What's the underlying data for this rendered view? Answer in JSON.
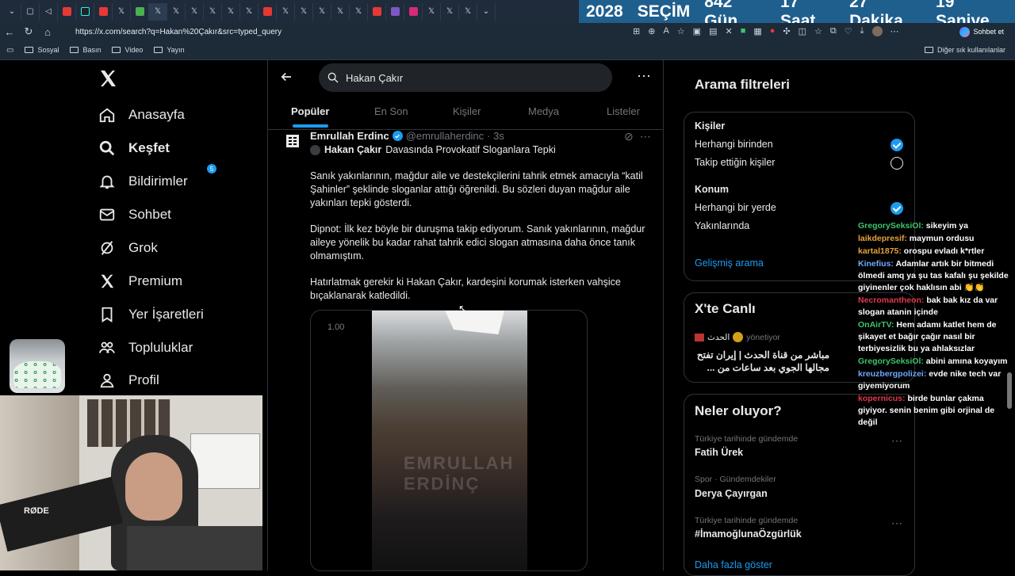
{
  "browser": {
    "countdown": [
      "2028",
      "SEÇİM",
      "842 Gün",
      "17 Saat",
      "27 Dakika",
      "19 Saniye"
    ],
    "url": "https://x.com/search?q=Hakan%20Çakır&src=typed_query",
    "chat_button": "Sohbet et",
    "bookmarks": [
      "Sosyal",
      "Basın",
      "Video",
      "Yayın"
    ],
    "other_bookmarks": "Diğer sık kullanılanlar"
  },
  "nav": {
    "items": [
      "Anasayfa",
      "Keşfet",
      "Bildirimler",
      "Sohbet",
      "Grok",
      "Premium",
      "Yer İşaretleri",
      "Topluluklar",
      "Profil"
    ],
    "notifications_badge": "5"
  },
  "search": {
    "query": "Hakan Çakır",
    "tabs": [
      "Popüler",
      "En Son",
      "Kişiler",
      "Medya",
      "Listeler"
    ]
  },
  "tweet": {
    "author": "Emrullah Erdinc",
    "handle": "@emrullaherdinc",
    "time": "· 3s",
    "headline_bold": "Hakan Çakır",
    "headline_rest": "Davasında Provokatif Sloganlara Tepki",
    "p1": "Sanık yakınlarının, mağdur aile ve destekçilerini tahrik etmek amacıyla “katil Şahinler” şeklinde sloganlar attığı öğrenildi. Bu sözleri duyan mağdur aile yakınları tepki gösterdi.",
    "p2": "Dipnot: İlk kez böyle bir duruşma takip ediyorum. Sanık yakınlarının, mağdur aileye yönelik bu kadar rahat tahrik edici slogan atmasına daha önce tanık olmamıştım.",
    "p3": "Hatırlatmak gerekir ki Hakan Çakır, kardeşini korumak isterken vahşice bıçaklanarak katledildi.",
    "video_speed": "1.00",
    "watermark": "EMRULLAH ERDİNÇ"
  },
  "filters": {
    "title": "Arama filtreleri",
    "people_label": "Kişiler",
    "people_opts": [
      "Herhangi birinden",
      "Takip ettiğin kişiler"
    ],
    "location_label": "Konum",
    "location_opts": [
      "Herhangi bir yerde",
      "Yakınlarında"
    ],
    "advanced": "Gelişmiş arama"
  },
  "live": {
    "title": "X'te Canlı",
    "channel": "الحدث",
    "role": "yönetiyor",
    "text": "مباشر من قناة الحدث | إيران تفتح مجالها الجوي بعد ساعات من ..."
  },
  "trends": {
    "title": "Neler oluyor?",
    "items": [
      {
        "sub": "Türkiye tarihinde gündemde",
        "main": "Fatih Ürek"
      },
      {
        "sub": "Spor · Gündemdekiler",
        "main": "Derya Çayırgan"
      },
      {
        "sub": "Türkiye tarihinde gündemde",
        "main": "#İmamoğlunaÖzgürlük"
      }
    ],
    "more": "Daha fazla göster"
  },
  "chat": [
    {
      "user": "GregorySeksiOl:",
      "text": "sikeyim ya",
      "color": "#3ec46d"
    },
    {
      "user": "laikdepresif:",
      "text": "maymun ordusu",
      "color": "#e6a23c"
    },
    {
      "user": "kartal1875:",
      "text": "orospu evladı k*rtler",
      "color": "#e6a23c"
    },
    {
      "user": "Kinefius:",
      "text": "Adamlar artık bir bitmedi ölmedi amq ya şu tas kafalı şu şekilde giyinenler çok haklısın abi 👏👏",
      "color": "#6ea8ff"
    },
    {
      "user": "Necromantheon:",
      "text": "bak bak kız da var slogan atanin içinde",
      "color": "#e2394b"
    },
    {
      "user": "OnAirTV:",
      "text": "Hem adamı katlet hem de şikayet et bağır çağır nasıl bir terbiyesizlik bu ya ahlaksızlar",
      "color": "#3ec46d"
    },
    {
      "user": "GregorySeksiOl:",
      "text": "abini amına koyayım",
      "color": "#3ec46d"
    },
    {
      "user": "kreuzbergpolizei:",
      "text": "evde nike tech var giyemiyorum",
      "color": "#6ea8ff"
    },
    {
      "user": "kopernicus:",
      "text": "birde bunlar çakma giyiyor. senin benim gibi orjinal de değil",
      "color": "#e2394b"
    }
  ]
}
